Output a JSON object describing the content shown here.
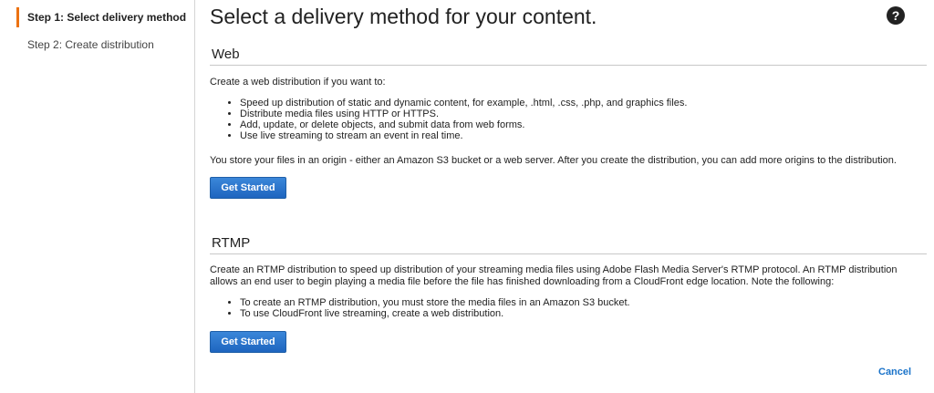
{
  "sidebar": {
    "steps": [
      {
        "label": "Step 1: Select delivery method",
        "active": true
      },
      {
        "label": "Step 2: Create distribution",
        "active": false
      }
    ]
  },
  "header": {
    "title": "Select a delivery method for your content.",
    "help_icon": "question-circle-icon"
  },
  "web": {
    "title": "Web",
    "intro": "Create a web distribution if you want to:",
    "bullets": [
      "Speed up distribution of static and dynamic content, for example, .html, .css, .php, and graphics files.",
      "Distribute media files using HTTP or HTTPS.",
      "Add, update, or delete objects, and submit data from web forms.",
      "Use live streaming to stream an event in real time."
    ],
    "note": "You store your files in an origin - either an Amazon S3 bucket or a web server. After you create the distribution, you can add more origins to the distribution.",
    "button_label": "Get Started"
  },
  "rtmp": {
    "title": "RTMP",
    "intro": "Create an RTMP distribution to speed up distribution of your streaming media files using Adobe Flash Media Server's RTMP protocol. An RTMP distribution allows an end user to begin playing a media file before the file has finished downloading from a CloudFront edge location. Note the following:",
    "bullets": [
      "To create an RTMP distribution, you must store the media files in an Amazon S3 bucket.",
      "To use CloudFront live streaming, create a web distribution."
    ],
    "button_label": "Get Started"
  },
  "footer": {
    "cancel_label": "Cancel"
  },
  "colors": {
    "active_step_accent": "#ec7211",
    "primary_button": "#1e65bf",
    "link": "#1a73c9"
  }
}
